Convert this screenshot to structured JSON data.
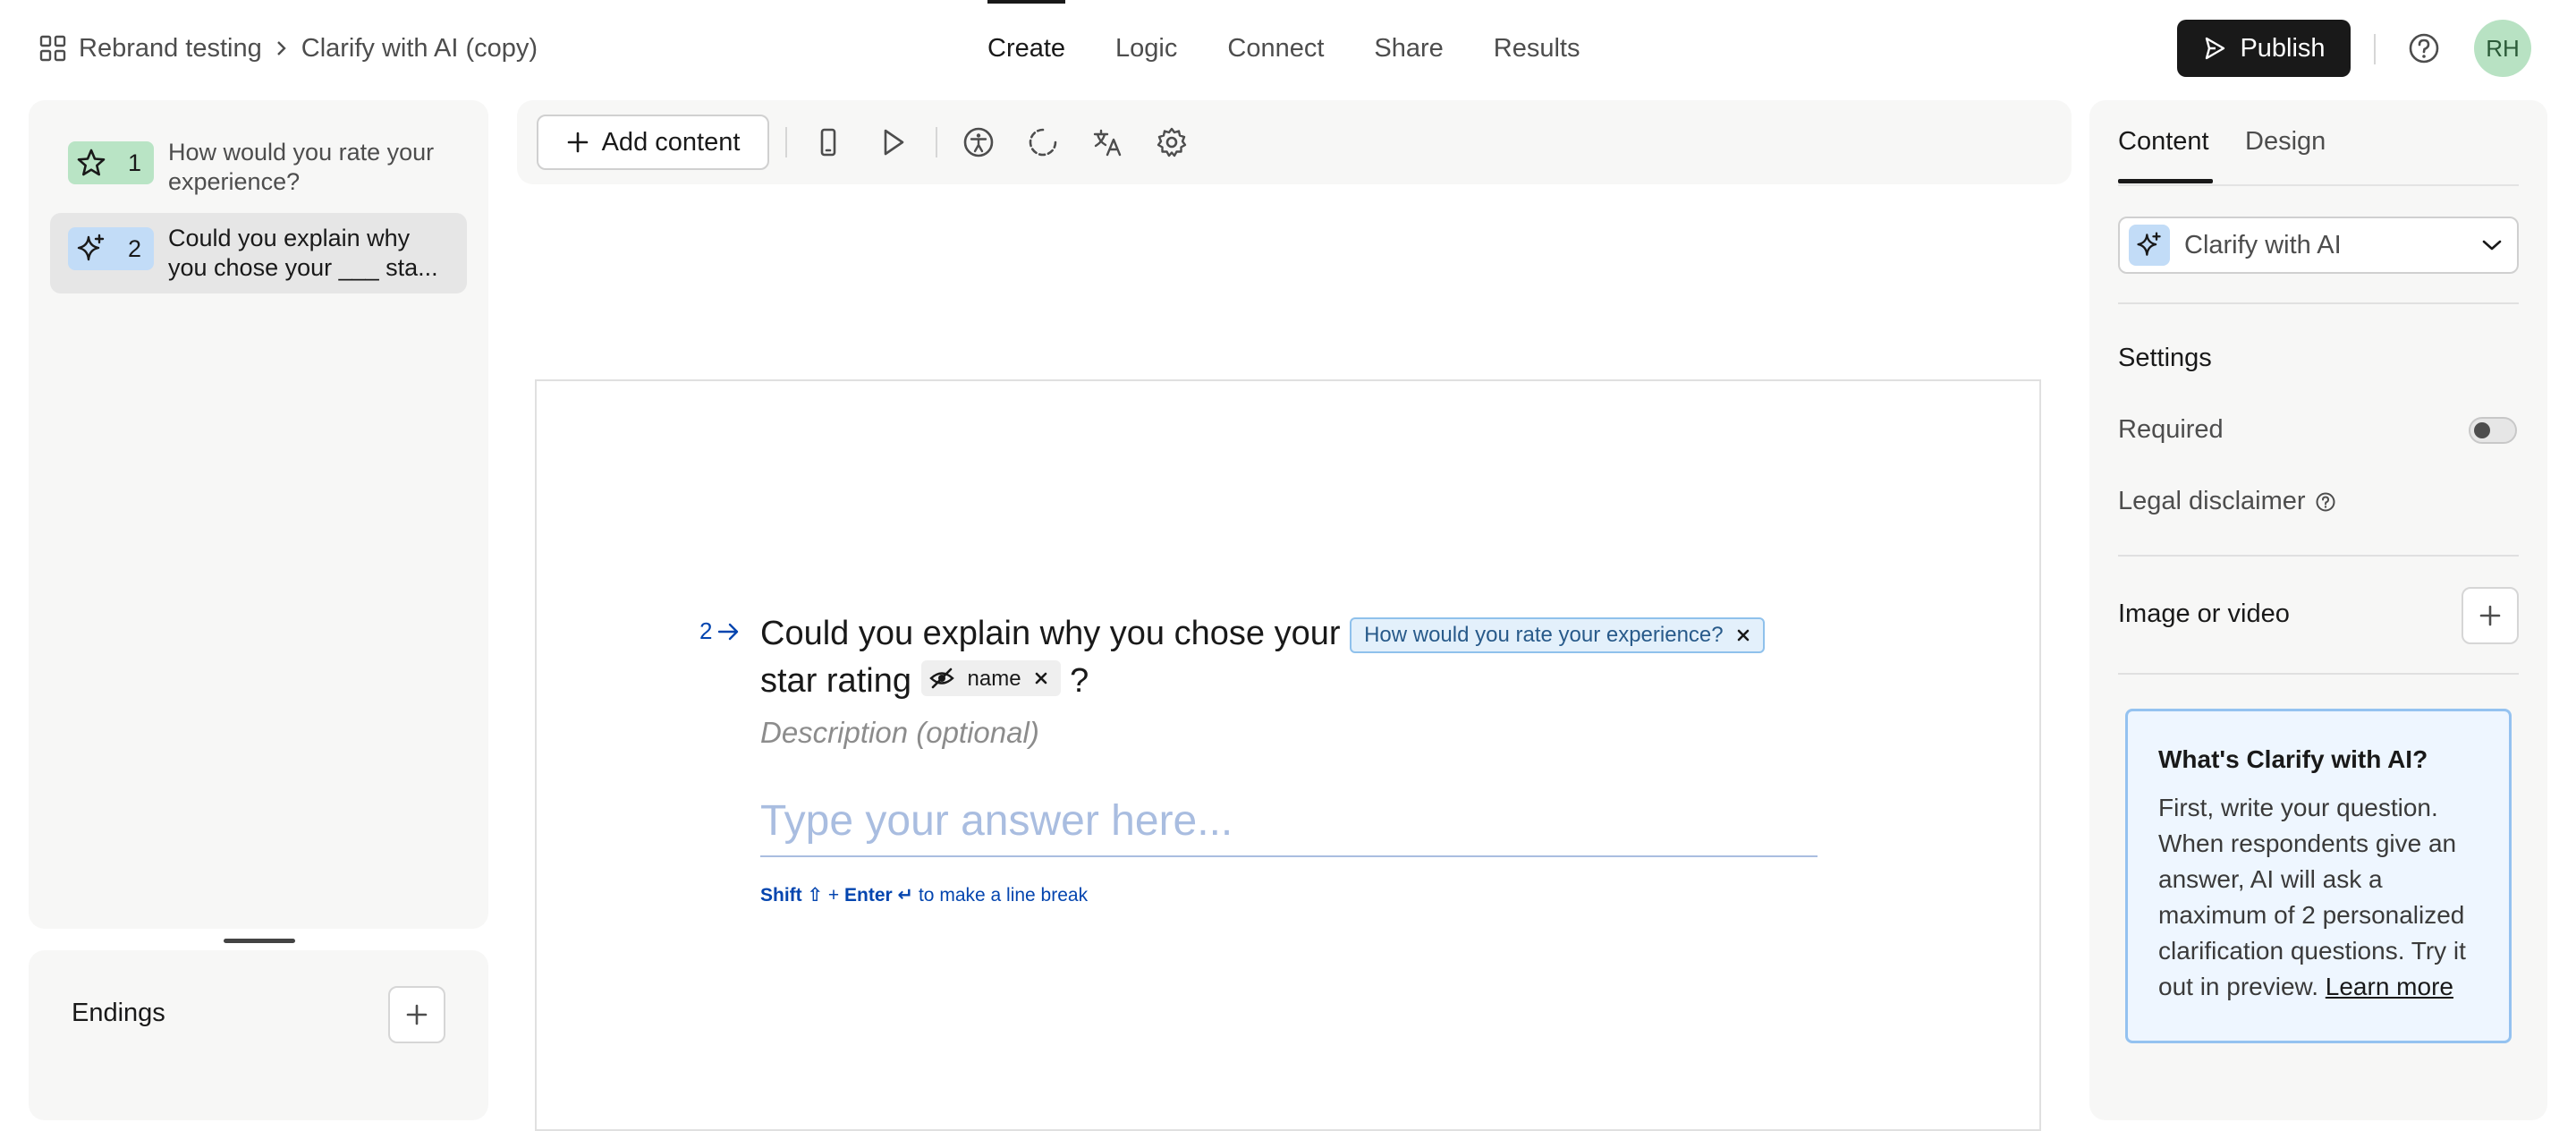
{
  "breadcrumb": {
    "workspace": "Rebrand testing",
    "form": "Clarify with AI (copy)"
  },
  "nav": {
    "tabs": [
      {
        "label": "Create",
        "active": true
      },
      {
        "label": "Logic",
        "active": false
      },
      {
        "label": "Connect",
        "active": false
      },
      {
        "label": "Share",
        "active": false
      },
      {
        "label": "Results",
        "active": false
      }
    ]
  },
  "header": {
    "publish_label": "Publish",
    "avatar_initials": "RH"
  },
  "questions": [
    {
      "number": "1",
      "text": "How would you rate your experience?",
      "icon": "star-icon",
      "color": "#b9e4c5",
      "selected": false
    },
    {
      "number": "2",
      "text": "Could you explain why you chose your ___ sta...",
      "icon": "sparkle-icon",
      "color": "#c2dcf7",
      "selected": true
    }
  ],
  "endings": {
    "title": "Endings"
  },
  "toolbar": {
    "add_content_label": "Add content",
    "icons": [
      "mobile-preview-icon",
      "play-icon",
      "accessibility-icon",
      "loading-icon",
      "translate-icon",
      "settings-icon"
    ]
  },
  "canvas": {
    "question_number": "2",
    "title_part1": "Could you explain why you chose your",
    "recall_pill": "How would you rate your experience?",
    "title_part2": "star rating",
    "variable_pill": "name",
    "title_end": "?",
    "description_placeholder": "Description (optional)",
    "answer_placeholder": "Type your answer here...",
    "hint_shift": "Shift ⇧",
    "hint_plus": " + ",
    "hint_enter": "Enter ↵",
    "hint_rest": " to make a line break"
  },
  "right_panel": {
    "tabs": [
      {
        "label": "Content",
        "active": true
      },
      {
        "label": "Design",
        "active": false
      }
    ],
    "question_type": "Clarify with AI",
    "settings_heading": "Settings",
    "required_label": "Required",
    "required_on": false,
    "legal_label": "Legal disclaimer",
    "media_heading": "Image or video",
    "info": {
      "title": "What's Clarify with AI?",
      "body": "First, write your question. When respondents give an answer, AI will ask a maximum of 2 personalized clarification questions. Try it out in preview.",
      "link": "Learn more"
    }
  },
  "colors": {
    "accent_blue": "#0445af",
    "publish_bg": "#191919",
    "avatar_bg": "#b8e2c3"
  }
}
